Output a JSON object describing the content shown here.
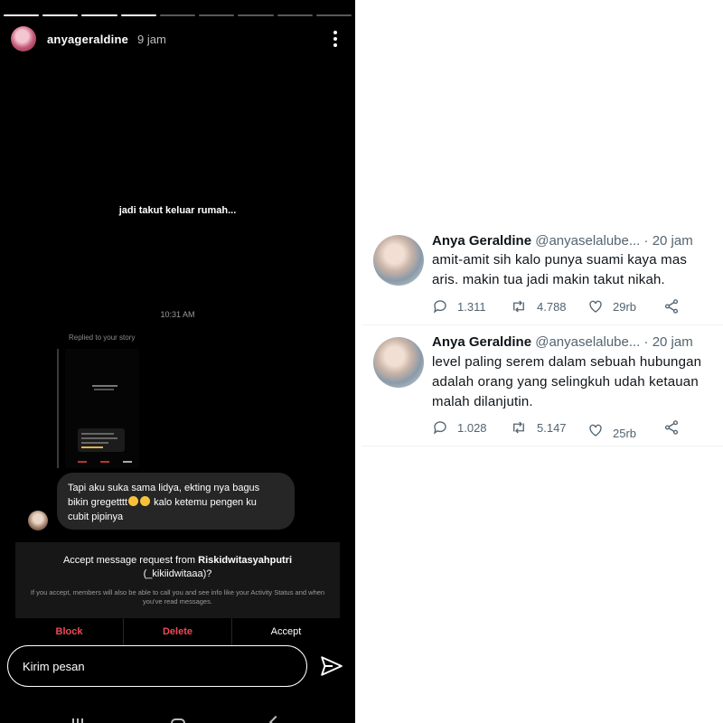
{
  "story": {
    "username": "anyageraldine",
    "time": "9 jam",
    "segments_total": 9,
    "segments_done": 4,
    "caption": "jadi takut keluar rumah..."
  },
  "chat": {
    "timestamp": "10:31 AM",
    "replied_label": "Replied to your story",
    "message_line1": "Tapi aku suka sama lidya, ekting nya bagus",
    "message_line2a": "bikin gregetttt",
    "message_line2b": "kalo ketemu pengen ku",
    "message_line3": "cubit pipinya"
  },
  "request": {
    "title_prefix": "Accept message request from",
    "requester_name": "Riskidwitasyahputri",
    "requester_handle": "(_kikiidwitaaa)?",
    "subtitle": "If you accept, members will also be able to call you and see info like your Activity Status and when you've read messages.",
    "block_label": "Block",
    "delete_label": "Delete",
    "accept_label": "Accept"
  },
  "composer": {
    "placeholder": "Kirim pesan"
  },
  "tweets": [
    {
      "name": "Anya Geraldine",
      "handle": "@anyaselalube...",
      "time": "· 20 jam",
      "line1": "amit-amit sih kalo punya suami kaya mas",
      "line2": "aris. makin tua jadi makin takut nikah.",
      "line3": "",
      "replies": "1.311",
      "retweets": "4.788",
      "likes": "29rb"
    },
    {
      "name": "Anya Geraldine",
      "handle": "@anyaselalube...",
      "time": "· 20 jam",
      "line1": "level paling serem dalam sebuah hubungan",
      "line2": "adalah orang yang selingkuh udah ketauan",
      "line3": "malah dilanjutin.",
      "replies": "1.028",
      "retweets": "5.147",
      "likes": "25rb"
    }
  ],
  "colors": {
    "ig_background": "#000000",
    "ig_danger": "#ed4956",
    "tw_text": "#0f1419",
    "tw_muted": "#536471"
  }
}
